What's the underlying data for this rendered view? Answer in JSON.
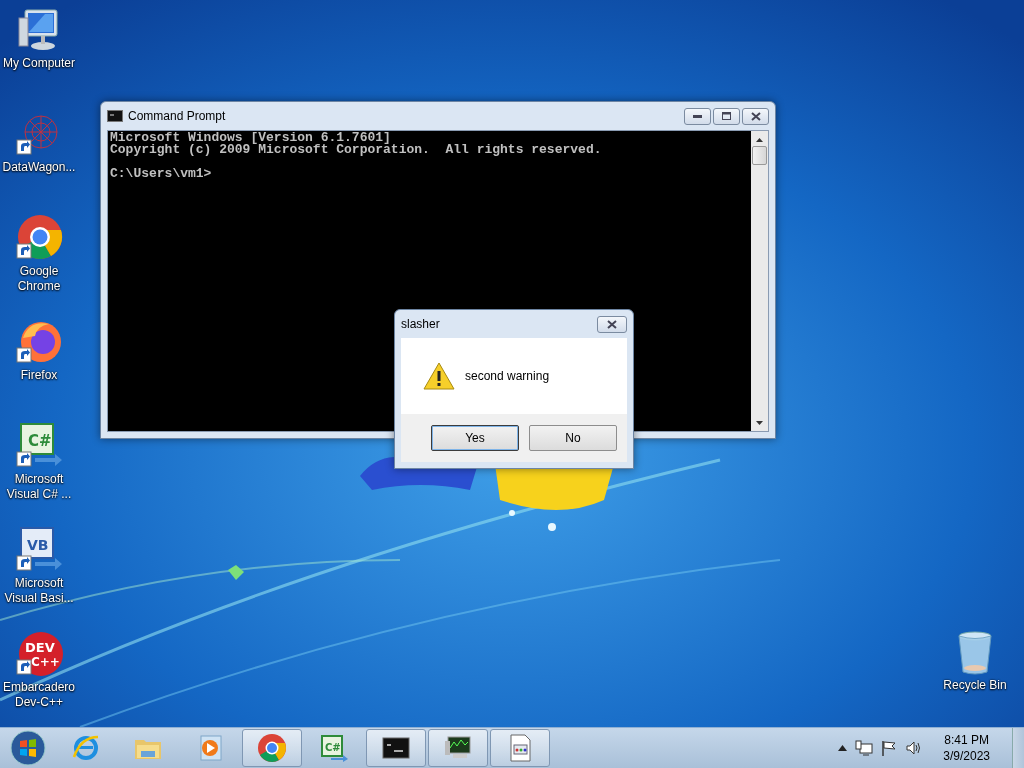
{
  "desktop_icons": [
    {
      "kind": "computer",
      "label": "My Computer"
    },
    {
      "kind": "datawagon",
      "label": "DataWagon..."
    },
    {
      "kind": "chrome",
      "label": "Google Chrome"
    },
    {
      "kind": "firefox",
      "label": "Firefox"
    },
    {
      "kind": "csharp",
      "glyph": "C#",
      "label": "Microsoft Visual C# ..."
    },
    {
      "kind": "vb",
      "glyph": "VB",
      "label": "Microsoft Visual Basi..."
    },
    {
      "kind": "devcpp",
      "glyph": "DEV",
      "glyph2": "C++",
      "label": "Embarcadero Dev-C++"
    }
  ],
  "recycle_bin": {
    "kind": "recycle",
    "label": "Recycle Bin"
  },
  "command_window": {
    "title": "Command Prompt",
    "lines": [
      "Microsoft Windows [Version 6.1.7601]",
      "Copyright (c) 2009 Microsoft Corporation.  All rights reserved."
    ],
    "prompt": "C:\\Users\\vm1>"
  },
  "dialog": {
    "title": "slasher",
    "message": "second warning",
    "buttons": [
      {
        "label": "Yes",
        "default": true
      },
      {
        "label": "No",
        "default": false
      }
    ]
  },
  "taskbar": {
    "items": [
      {
        "kind": "ie",
        "open": false
      },
      {
        "kind": "explorer",
        "open": false
      },
      {
        "kind": "media",
        "open": false
      },
      {
        "kind": "chrome",
        "open": true
      },
      {
        "kind": "csharp",
        "glyph": "C#",
        "open": false
      },
      {
        "kind": "cmd",
        "open": true
      },
      {
        "kind": "monitor",
        "open": true
      },
      {
        "kind": "document",
        "open": true
      }
    ],
    "time": "8:41 PM",
    "date": "3/9/2023"
  }
}
